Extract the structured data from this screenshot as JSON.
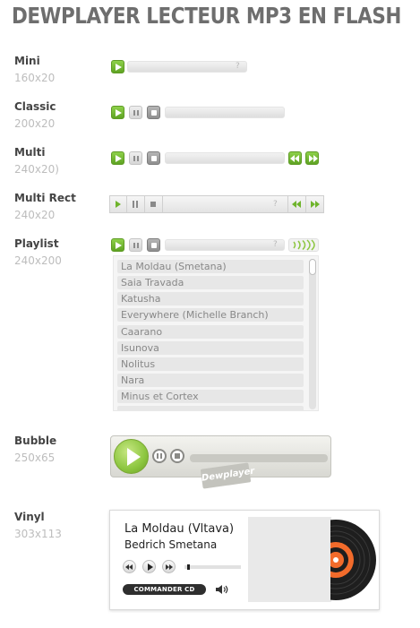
{
  "page": {
    "title": "DEWPLAYER LECTEUR MP3 EN FLASH"
  },
  "players": {
    "mini": {
      "label": "Mini",
      "size": "160x20",
      "help": "?"
    },
    "classic": {
      "label": "Classic",
      "size": "200x20"
    },
    "multi": {
      "label": "Multi",
      "size": "240x20)"
    },
    "multirect": {
      "label": "Multi Rect",
      "size": "240x20",
      "help": "?"
    },
    "playlist": {
      "label": "Playlist",
      "size": "240x200",
      "help": "?",
      "items": [
        "La Moldau (Smetana)",
        "Saia Travada",
        "Katusha",
        "Everywhere (Michelle Branch)",
        "Caarano",
        "Isunova",
        "Nolitus",
        "Nara",
        "Minus et Cortex"
      ]
    },
    "bubble": {
      "label": "Bubble",
      "size": "250x65",
      "tag": "Dewplayer"
    },
    "vinyl": {
      "label": "Vinyl",
      "size": "303x113",
      "track_title": "La Moldau (Vltava)",
      "track_artist": "Bedrich Smetana",
      "button": "COMMANDER CD",
      "progress": 0.05
    }
  },
  "colors": {
    "accent_green": "#6fb42c",
    "title_gray": "#6e6e6e",
    "muted_text": "#bdbdbd",
    "vinyl_orange": "#f26b2b"
  }
}
